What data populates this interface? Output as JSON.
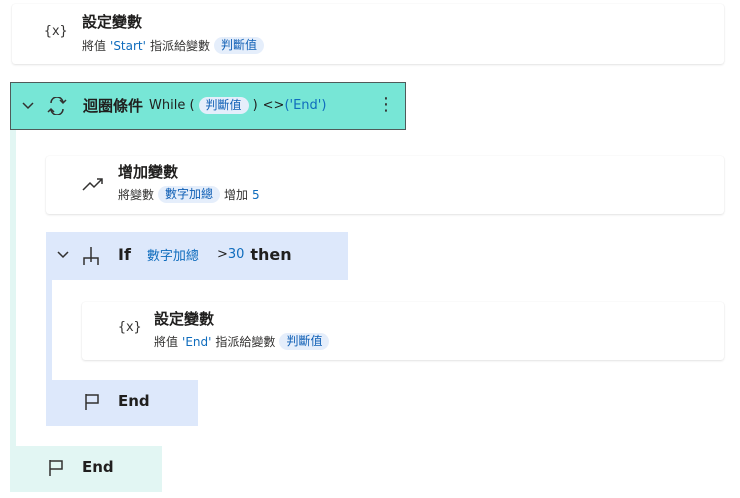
{
  "actions": {
    "set_var_1": {
      "icon": "variable-icon",
      "icon_text": "{x}",
      "title": "設定變數",
      "prefix": "將值",
      "value": "'Start'",
      "middle": "指派給變數",
      "variable": "判斷值"
    },
    "while_loop": {
      "title": "迴圈條件",
      "keyword": "While (",
      "variable": "判斷值",
      "close": ")",
      "operator": "<>",
      "value": "('End')",
      "more_glyph": "⋮"
    },
    "increase_var": {
      "title": "增加變數",
      "prefix": "將變數",
      "variable": "數字加總",
      "middle": "增加",
      "amount": "5"
    },
    "if_block": {
      "keyword": "If",
      "variable": "數字加總",
      "operator": ">",
      "value": "30",
      "then": "then"
    },
    "set_var_2": {
      "icon_text": "{x}",
      "title": "設定變數",
      "prefix": "將值",
      "value": "'End'",
      "middle": "指派給變數",
      "variable": "判斷值"
    },
    "end_if": {
      "label": "End"
    },
    "end_loop": {
      "label": "End"
    }
  },
  "colors": {
    "loop_header": "#77e6d6",
    "loop_rail": "#e2f6f3",
    "if_bg": "#dde8fb",
    "pill_bg": "#e5eefb",
    "accent_blue": "#0f6cbd"
  }
}
